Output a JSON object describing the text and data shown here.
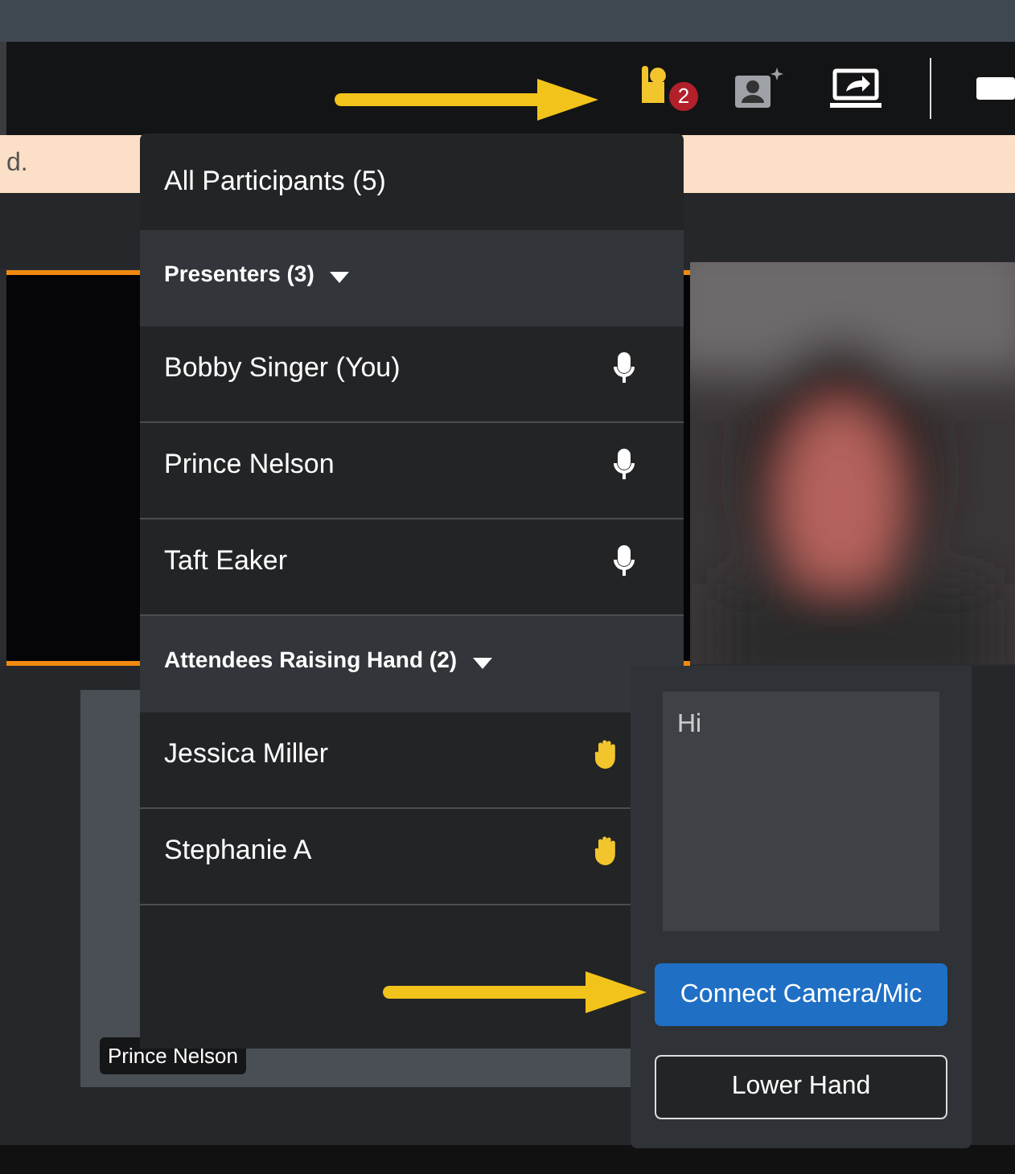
{
  "toolbar": {
    "hand_badge": "2"
  },
  "banner": {
    "text": "d."
  },
  "participants": {
    "title": "All Participants (5)",
    "groups": [
      {
        "label": "Presenters (3)",
        "expanded": true,
        "members": [
          {
            "name": "Bobby Singer (You)",
            "kind": "mic"
          },
          {
            "name": "Prince Nelson",
            "kind": "mic"
          },
          {
            "name": "Taft Eaker",
            "kind": "mic"
          }
        ]
      },
      {
        "label": "Attendees Raising Hand (2)",
        "expanded": true,
        "members": [
          {
            "name": "Jessica Miller",
            "kind": "hand"
          },
          {
            "name": "Stephanie A",
            "kind": "hand"
          }
        ]
      }
    ]
  },
  "video_tile": {
    "name_label": "Prince Nelson"
  },
  "hand_panel": {
    "message": "Hi",
    "buttons": [
      {
        "label": "Connect Camera/Mic",
        "kind": "primary"
      },
      {
        "label": "Lower Hand",
        "kind": "outline"
      }
    ]
  }
}
